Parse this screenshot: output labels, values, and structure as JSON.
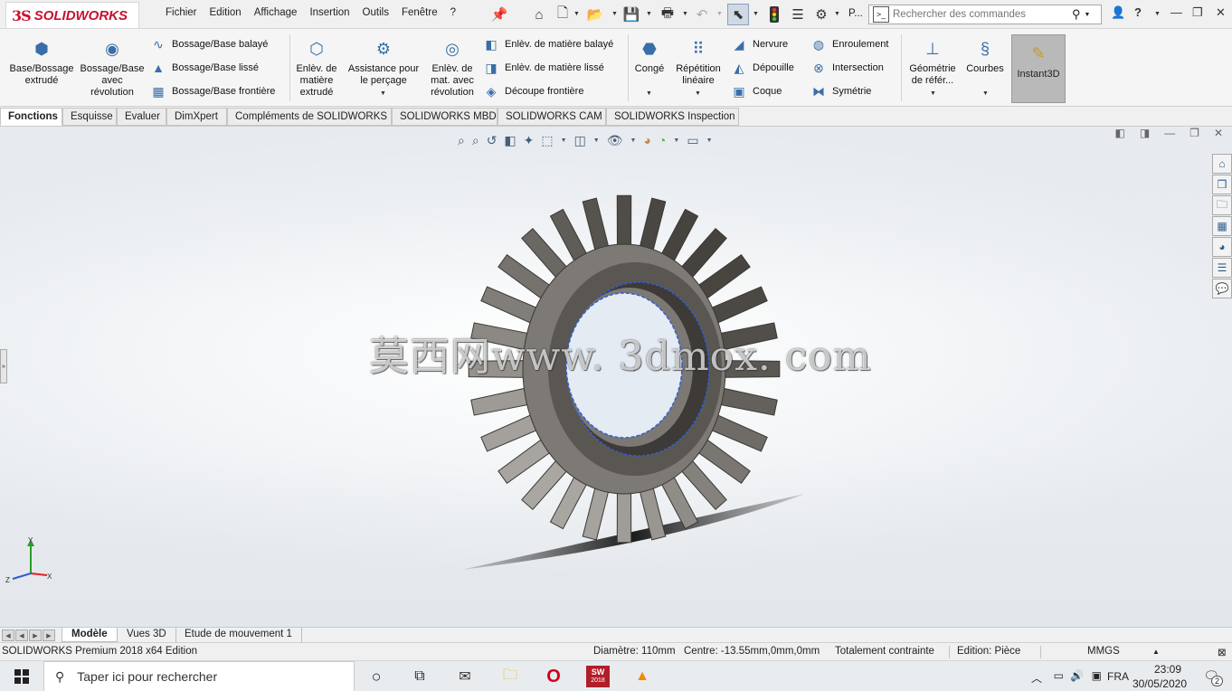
{
  "app": {
    "brand_ds": "3S",
    "brand_name": "SOLIDWORKS",
    "menus": [
      "Fichier",
      "Edition",
      "Affichage",
      "Insertion",
      "Outils",
      "Fenêtre",
      "?"
    ],
    "truncated_label": "P...",
    "command_search_placeholder": "Rechercher des commandes"
  },
  "ribbon": {
    "base_extrude": "Base/Bossage extrudé",
    "revolve": "Bossage/Base avec révolution",
    "swept": "Bossage/Base balayé",
    "loft": "Bossage/Base lissé",
    "boundary": "Bossage/Base frontière",
    "cut_extrude": "Enlèv. de matière extrudé",
    "hole_wizard": "Assistance pour le perçage",
    "cut_revolve": "Enlèv. de mat. avec révolution",
    "cut_swept": "Enlèv. de matière balayé",
    "cut_loft": "Enlèv. de matière lissé",
    "cut_boundary": "Découpe frontière",
    "fillet": "Congé",
    "linear_pattern": "Répétition linéaire",
    "rib": "Nervure",
    "draft": "Dépouille",
    "shell": "Coque",
    "wrap": "Enroulement",
    "intersect": "Intersection",
    "mirror": "Symétrie",
    "ref_geometry": "Géométrie de référ...",
    "curves": "Courbes",
    "instant3d": "Instant3D"
  },
  "tabs": [
    "Fonctions",
    "Esquisse",
    "Evaluer",
    "DimXpert",
    "Compléments de SOLIDWORKS",
    "SOLIDWORKS MBD",
    "SOLIDWORKS CAM",
    "SOLIDWORKS Inspection"
  ],
  "viewport": {
    "watermark": "莫西网www. 3dmox. com",
    "triad": {
      "y": "Y",
      "z": "Z",
      "x": "X"
    }
  },
  "bottom_tabs": [
    "Modèle",
    "Vues 3D",
    "Etude de mouvement 1"
  ],
  "status": {
    "edition": "SOLIDWORKS Premium 2018 x64 Edition",
    "diameter": "Diamètre: 110mm",
    "center": "Centre: -13.55mm,0mm,0mm",
    "constraint": "Totalement contrainte",
    "editing": "Edition: Pièce",
    "units": "MMGS"
  },
  "taskbar": {
    "search_placeholder": "Taper ici pour rechercher",
    "sw_badge": "2018",
    "language": "FRA",
    "time": "23:09",
    "date": "30/05/2020",
    "notifications": "2"
  },
  "colors": {
    "brand_red": "#c8102e",
    "ribbon_bg": "#f5f5f5",
    "instant3d_active": "#b9b9b9",
    "gear_face": "#8e8a86",
    "selection_blue": "#2f5fd6"
  }
}
